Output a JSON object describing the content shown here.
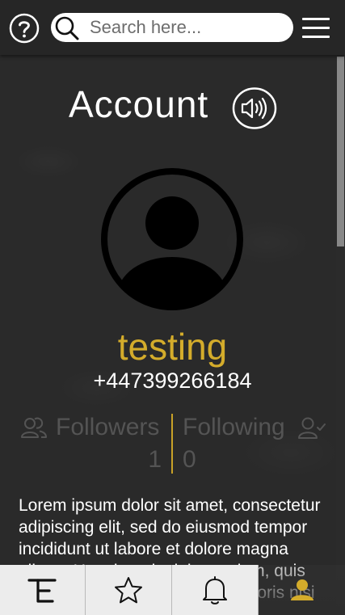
{
  "topbar": {
    "search_placeholder": "Search here..."
  },
  "icons": {
    "help": "help-icon",
    "search": "search-icon",
    "menu": "hamburger-menu-icon",
    "sound": "speaker-icon",
    "avatar": "user-avatar-icon",
    "followers": "users-icon",
    "following": "user-check-icon",
    "logo": "te-logo-icon",
    "favorites": "star-icon",
    "notifications": "bell-icon",
    "profile": "person-icon"
  },
  "account": {
    "title": "Account",
    "username": "testing",
    "phone": "+447399266184",
    "followers_label": "Followers",
    "followers_count": "1",
    "following_label": "Following",
    "following_count": "0",
    "bio": "Lorem ipsum dolor sit amet, consectetur adipiscing elit, sed do eiusmod tempor incididunt ut labore et dolore magna aliqua. Ut enim ad minim veniam, quis nostrud exercitation ullamco laboris nisi ut"
  },
  "colors": {
    "accent": "#d4ac2b",
    "background": "#2a2a2a",
    "topbar": "#262626",
    "muted_text": "#545454",
    "nav_background": "#ececec"
  }
}
